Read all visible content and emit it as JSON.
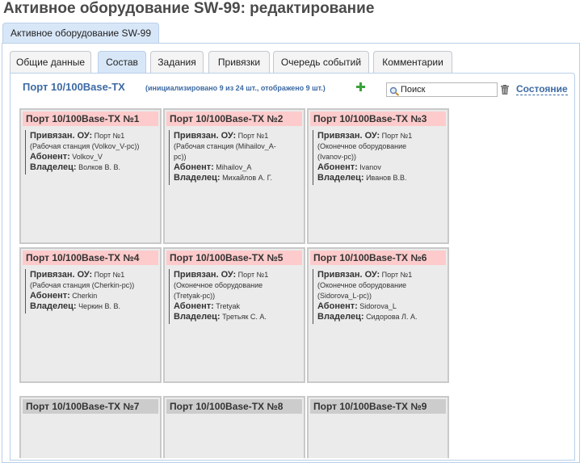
{
  "page_title": "Активное оборудование SW-99: редактирование",
  "outer_tab": "Активное оборудование SW-99",
  "tabs": [
    {
      "label": "Общие данные",
      "active": false
    },
    {
      "label": "Состав",
      "active": true
    },
    {
      "label": "Задания",
      "active": false
    },
    {
      "label": "Привязки",
      "active": false
    },
    {
      "label": "Очередь событий",
      "active": false
    },
    {
      "label": "Комментарии",
      "active": false
    }
  ],
  "section": {
    "title": "Порт 10/100Base-TX",
    "info": "(инициализировано 9 из 24 шт., отображено 9 шт.)",
    "add_icon": "plus-icon",
    "search_placeholder": "Поиск",
    "state_link": "Состояние"
  },
  "labels": {
    "bound": "Привязан. ОУ:",
    "subscriber": "Абонент:",
    "owner": "Владелец:"
  },
  "colors": {
    "bound_header": "#fdcbcb",
    "free_header": "#cccccc",
    "accent": "#3d6aa3"
  },
  "ports": [
    {
      "title": "Порт 10/100Base-TX №1",
      "bound_line1": "Порт №1",
      "bound_line2": "(Рабочая станция (Volkov_V-pc))",
      "bound_line3": "",
      "subscriber": "Volkov_V",
      "owner": "Волков В. В."
    },
    {
      "title": "Порт 10/100Base-TX №2",
      "bound_line1": "Порт №1",
      "bound_line2": "(Рабочая станция (Mihailov_A-",
      "bound_line3": "pc))",
      "subscriber": "Mihailov_A",
      "owner": "Михайлов А. Г."
    },
    {
      "title": "Порт 10/100Base-TX №3",
      "bound_line1": "Порт №1",
      "bound_line2": "(Оконечное оборудование",
      "bound_line3": "(Ivanov-pc))",
      "subscriber": "Ivanov",
      "owner": "Иванов В.В."
    },
    {
      "title": "Порт 10/100Base-TX №4",
      "bound_line1": "Порт №1",
      "bound_line2": "(Рабочая станция (Cherkin-pc))",
      "bound_line3": "",
      "subscriber": "Cherkin",
      "owner": "Черкин В. В."
    },
    {
      "title": "Порт 10/100Base-TX №5",
      "bound_line1": "Порт №1",
      "bound_line2": "(Оконечное оборудование",
      "bound_line3": "(Tretyak-pc))",
      "subscriber": "Tretyak",
      "owner": "Третьяк С. А."
    },
    {
      "title": "Порт 10/100Base-TX №6",
      "bound_line1": "Порт №1",
      "bound_line2": "(Оконечное оборудование",
      "bound_line3": "(Sidorova_L-pc))",
      "subscriber": "Sidorova_L",
      "owner": "Сидорова Л. А."
    },
    {
      "title": "Порт 10/100Base-TX №7"
    },
    {
      "title": "Порт 10/100Base-TX №8"
    },
    {
      "title": "Порт 10/100Base-TX №9"
    }
  ]
}
